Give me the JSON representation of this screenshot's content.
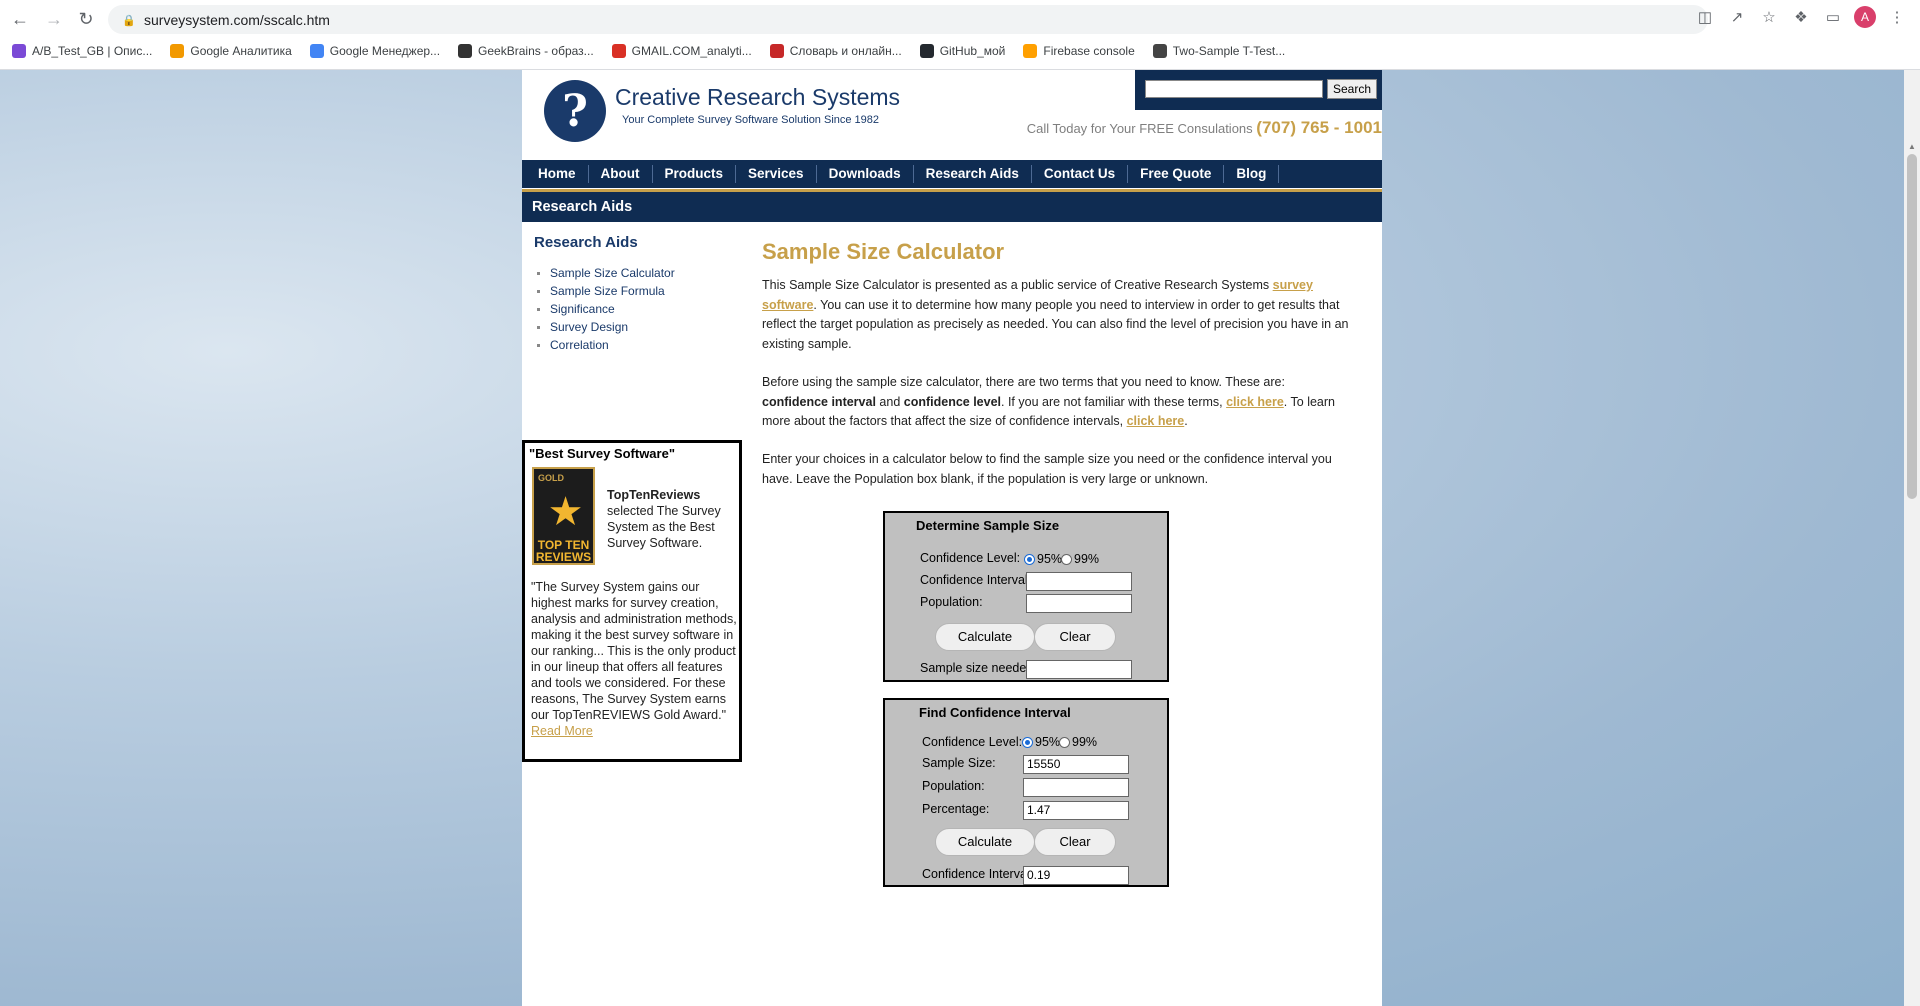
{
  "browser": {
    "url": "surveysystem.com/sscalc.htm",
    "avatar_letter": "A",
    "bookmarks": [
      {
        "label": "A/B_Test_GB | Опис...",
        "icon": "clickup-icon",
        "color": "#7b4ad6"
      },
      {
        "label": "Google Аналитика",
        "icon": "analytics-icon",
        "color": "#f29900"
      },
      {
        "label": "Google Менеджер...",
        "icon": "tag-manager-icon",
        "color": "#4285f4"
      },
      {
        "label": "GeekBrains - образ...",
        "icon": "geekbrains-icon",
        "color": "#333333"
      },
      {
        "label": "GMAIL.COM_analyti...",
        "icon": "gmail-icon",
        "color": "#d93025"
      },
      {
        "label": "Словарь и онлайн...",
        "icon": "dictionary-icon",
        "color": "#c62828"
      },
      {
        "label": "GitHub_мой",
        "icon": "github-icon",
        "color": "#24292f"
      },
      {
        "label": "Firebase console",
        "icon": "firebase-icon",
        "color": "#ffa000"
      },
      {
        "label": "Two-Sample T-Test...",
        "icon": "ttest-icon",
        "color": "#444444"
      }
    ]
  },
  "site": {
    "logo_name": "Creative Research Systems",
    "logo_tagline": "Your Complete Survey Software Solution Since 1982",
    "search_button": "Search",
    "call_text": "Call Today for Your FREE Consulations",
    "phone": "(707) 765 - 1001",
    "nav": [
      "Home",
      "About",
      "Products",
      "Services",
      "Downloads",
      "Research Aids",
      "Contact Us",
      "Free Quote",
      "Blog"
    ],
    "section_title": "Research Aids"
  },
  "sidebar": {
    "title": "Research Aids",
    "items": [
      "Sample Size Calculator",
      "Sample Size Formula",
      "Significance",
      "Survey Design",
      "Correlation"
    ],
    "award": {
      "title": "\"Best Survey Software\"",
      "badge_gold": "GOLD",
      "badge_text": "TOP TEN REVIEWS",
      "org": "TopTenReviews",
      "summary": "selected The Survey System as the Best Survey Software.",
      "quote": "\"The Survey System gains our highest marks for survey creation, analysis and administration methods, making it the best survey software in our ranking... This is the only product in our lineup that offers all features and tools we considered. For these reasons, The Survey System earns our TopTenREVIEWS Gold Award.\"",
      "read_more": "Read More"
    }
  },
  "main": {
    "title": "Sample Size Calculator",
    "p1_a": "This Sample Size Calculator is presented as a public service of Creative Research Systems ",
    "p1_link": "survey software",
    "p1_b": ". You can use it to determine how many people you need to interview in order to get results that reflect the target population as precisely as needed. You can also find the level of precision you have in an existing sample.",
    "p2_a": "Before using the sample size calculator, there are two terms that you need to know. These are: ",
    "p2_b1": "confidence interval",
    "p2_and": " and ",
    "p2_b2": "confidence level",
    "p2_c": ". If you are not familiar with these terms, ",
    "p2_link1": "click here",
    "p2_d": ". To learn more about the factors that affect the size of confidence intervals, ",
    "p2_link2": "click here",
    "p2_e": ".",
    "p3": "Enter your choices in a calculator below to find the sample size you need or the confidence interval you have. Leave the Population box blank, if the population is very large or unknown."
  },
  "calc1": {
    "title": "Determine Sample Size",
    "conf_level_label": "Confidence Level:",
    "opt95": "95%",
    "opt99": "99%",
    "selected": "95%",
    "conf_interval_label": "Confidence Interval:",
    "conf_interval_value": "",
    "population_label": "Population:",
    "population_value": "",
    "calculate": "Calculate",
    "clear": "Clear",
    "result_label": "Sample size needed:",
    "result_value": ""
  },
  "calc2": {
    "title": "Find Confidence Interval",
    "conf_level_label": "Confidence Level:",
    "opt95": "95%",
    "opt99": "99%",
    "selected": "95%",
    "sample_size_label": "Sample Size:",
    "sample_size_value": "15550",
    "population_label": "Population:",
    "population_value": "",
    "percentage_label": "Percentage:",
    "percentage_value": "1.47",
    "calculate": "Calculate",
    "clear": "Clear",
    "result_label": "Confidence Interval:",
    "result_value": "0.19"
  }
}
